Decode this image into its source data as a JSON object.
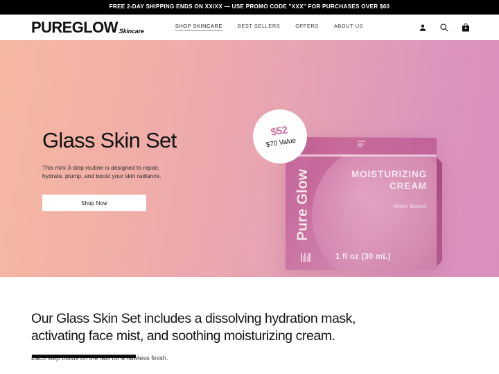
{
  "announcement": {
    "text": "FREE 2-DAY SHIPPING ENDS ON XX/XX  —  USE PROMO CODE \"XXX\" FOR PURCHASES OVER $60"
  },
  "header": {
    "logo_main": "PUREGLOW",
    "logo_sub": "Skincare",
    "nav": [
      {
        "label": "SHOP SKINCARE",
        "active": true
      },
      {
        "label": "BEST SELLERS",
        "active": false
      },
      {
        "label": "OFFERS",
        "active": false
      },
      {
        "label": "ABOUT US",
        "active": false
      }
    ],
    "icons": [
      {
        "name": "account-icon"
      },
      {
        "name": "search-icon"
      },
      {
        "name": "shopping-bag-icon"
      }
    ]
  },
  "hero": {
    "title": "Glass Skin Set",
    "subtitle": "This mini 3-step routine is designed to repair, hydrate, plump, and boost your skin radiance.",
    "cta_label": "Shop Now",
    "gradient_from": "#f6b9a2",
    "gradient_to": "#d98fbd",
    "badge": {
      "price": "$52",
      "value": "$70 Value",
      "price_color": "#d06fa5"
    },
    "product": {
      "brand": "Pure Glow",
      "name_line1": "MOISTURIZING",
      "name_line2": "CREAM",
      "descriptor": "Water Based",
      "size": "1 fl oz (30 mL)",
      "box_color": "#cb76a4"
    }
  },
  "lower": {
    "heading": "Our Glass Skin Set includes a dissolving hydration mask, activating face mist, and soothing moisturizing cream.",
    "subheading": "Each step builds on the last for a flawless finish."
  }
}
